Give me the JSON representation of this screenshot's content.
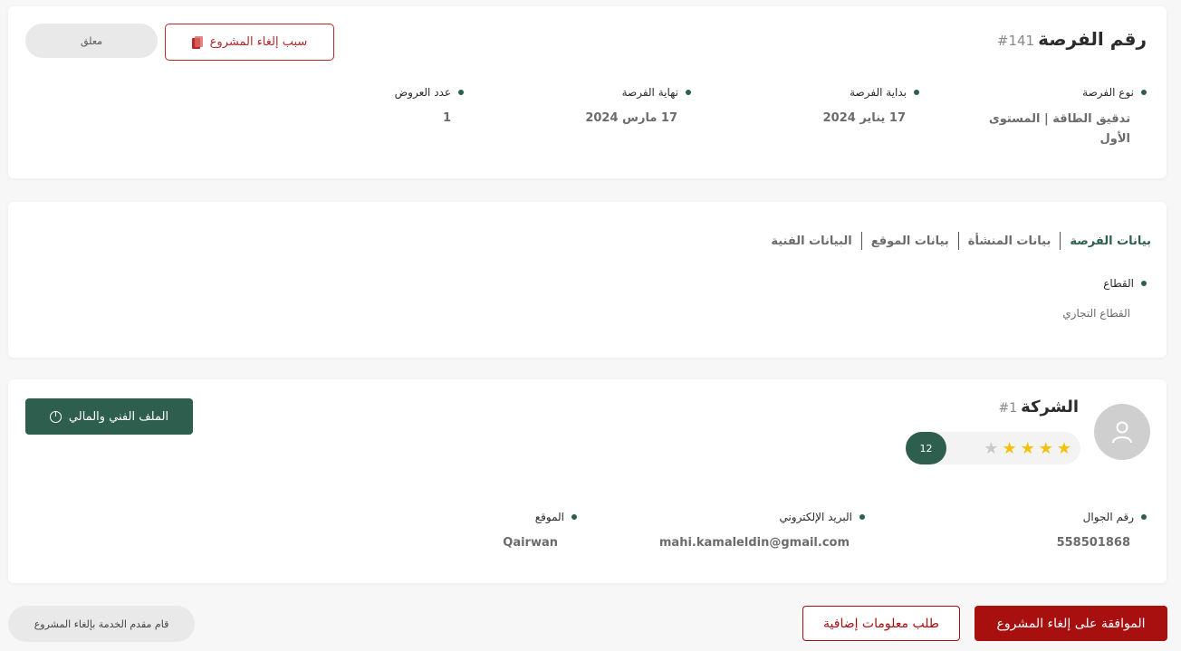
{
  "opportunity": {
    "title": "رقم الفرصة",
    "number": "#141",
    "status": "معلق",
    "cancel_reason_label": "سبب إلغاء المشروع",
    "fields": {
      "type_label": "نوع الفرصة",
      "type_value": "تدقيق الطاقة | المستوى الأول",
      "start_label": "بداية الفرصة",
      "start_value": "17 يناير 2024",
      "end_label": "نهاية الفرصة",
      "end_value": "17 مارس 2024",
      "offers_label": "عدد العروض",
      "offers_value": "1"
    }
  },
  "tabs": {
    "items": [
      "بيانات الفرصة",
      "بيانات المنشأة",
      "بيانات الموقع",
      "البيانات الفنية"
    ],
    "active_index": 0,
    "sector_label": "القطاع",
    "sector_value": "القطاع التجاري"
  },
  "company": {
    "title": "الشركة",
    "number": "#1",
    "rating": {
      "stars_filled": 4,
      "stars_total": 5,
      "count": "12"
    },
    "file_button_label": "الملف الفني والمالي",
    "fields": {
      "phone_label": "رقم الجوال",
      "phone_value": "558501868",
      "email_label": "البريد الإلكتروني",
      "email_value": "mahi.kamaleldin@gmail.com",
      "location_label": "الموقع",
      "location_value": "Qairwan"
    }
  },
  "actions": {
    "approve_label": "الموافقة على إلغاء المشروع",
    "request_label": "طلب معلومات إضافية",
    "provider_status": "قام مقدم الخدمة بإلغاء المشروع"
  },
  "colors": {
    "primary_green": "#2e5f4e",
    "danger_red": "#a80f0f",
    "star": "#f2c20a"
  },
  "icons": {
    "cancel_reason": "document-copy-icon",
    "file_button": "pie-chart-icon",
    "avatar": "user-icon",
    "bullet": "dot-icon",
    "star": "star-icon"
  }
}
